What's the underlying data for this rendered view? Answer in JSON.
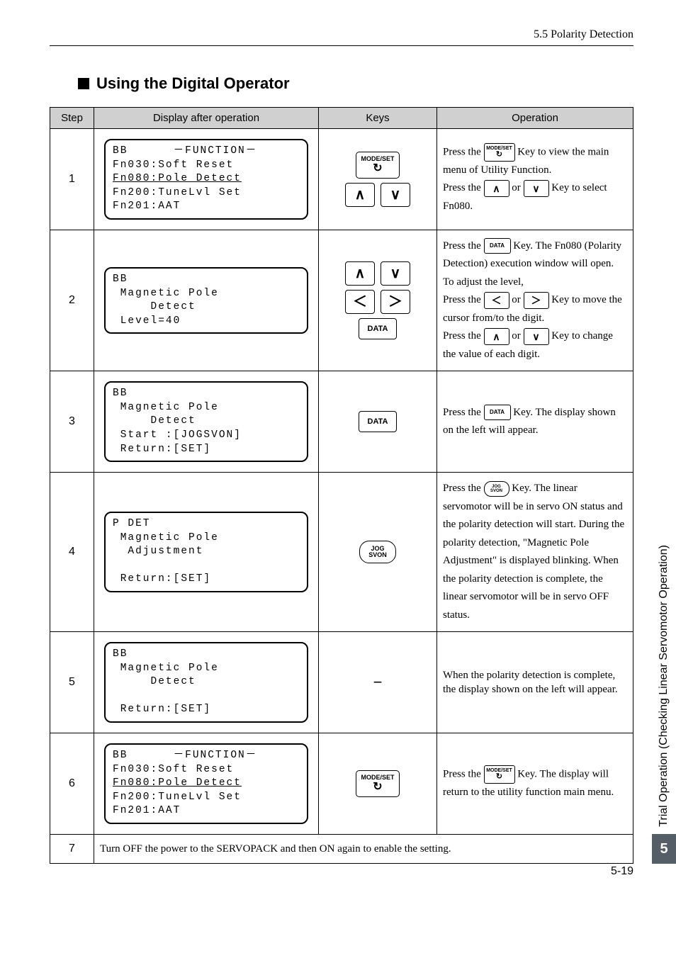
{
  "header": {
    "right": "5.5  Polarity Detection"
  },
  "section_title": "Using the Digital Operator",
  "table": {
    "headers": {
      "step": "Step",
      "display": "Display after operation",
      "keys": "Keys",
      "operation": "Operation"
    }
  },
  "rows": {
    "r1": {
      "step": "1",
      "lcd": {
        "l1a": "BB",
        "l1b": "－FUNCTION－",
        "l2": "Fn030:Soft Reset",
        "l3": "Fn080:Pole Detect",
        "l4": "Fn200:TuneLvl Set",
        "l5": "Fn201:AAT"
      },
      "keys": {
        "modeset": "MODE/SET",
        "up": "∧",
        "down": "∨"
      },
      "op": {
        "t1a": "Press the ",
        "t1b": " Key to view the main menu of Utility Function.",
        "t2a": "Press the ",
        "t2b": " or ",
        "t2c": " Key to select Fn080."
      }
    },
    "r2": {
      "step": "2",
      "lcd": {
        "l1": "BB",
        "l2": " Magnetic Pole",
        "l3": "     Detect",
        "l4": " Level=40"
      },
      "keys": {
        "up": "∧",
        "down": "∨",
        "left": "＜",
        "right": "＞",
        "data": "DATA"
      },
      "op": {
        "t1a": "Press the ",
        "t1b": " Key. The Fn080 (Polarity Detection) execution window will open.",
        "t2": "To adjust the level,",
        "t3a": "Press the ",
        "t3b": " or ",
        "t3c": " Key to move the cursor from/to the digit.",
        "t4a": "Press the ",
        "t4b": " or ",
        "t4c": " Key to change the value of each digit."
      }
    },
    "r3": {
      "step": "3",
      "lcd": {
        "l1": "BB",
        "l2": " Magnetic Pole",
        "l3": "     Detect",
        "l4": " Start :[JOGSVON]",
        "l5": " Return:[SET]"
      },
      "keys": {
        "data": "DATA"
      },
      "op": {
        "t1a": "Press the ",
        "t1b": " Key. The display shown on the left will appear."
      }
    },
    "r4": {
      "step": "4",
      "lcd": {
        "l1": "P DET",
        "l2": " Magnetic Pole",
        "l3": "  Adjustment",
        "l4": "",
        "l5": " Return:[SET]"
      },
      "keys": {
        "jog1": "JOG",
        "jog2": "SVON"
      },
      "op": {
        "t1a": "Press the ",
        "t1b": " Key. The linear servomotor will be in servo ON status and the polarity detection will start. During the polarity detection, \"Magnetic Pole Adjustment\" is displayed blinking. When the polarity detection is complete, the linear servomotor will be in servo OFF status."
      }
    },
    "r5": {
      "step": "5",
      "lcd": {
        "l1": "BB",
        "l2": " Magnetic Pole",
        "l3": "     Detect",
        "l4": "",
        "l5": " Return:[SET]"
      },
      "keys": {
        "dash": "−"
      },
      "op": {
        "t1": "When the polarity detection is complete, the display shown on the left will appear."
      }
    },
    "r6": {
      "step": "6",
      "lcd": {
        "l1a": "BB",
        "l1b": "－FUNCTION－",
        "l2": "Fn030:Soft Reset",
        "l3": "Fn080:Pole Detect",
        "l4": "Fn200:TuneLvl Set",
        "l5": "Fn201:AAT"
      },
      "keys": {
        "modeset": "MODE/SET"
      },
      "op": {
        "t1a": "Press the ",
        "t1b": " Key. The display will return to the utility function main menu."
      }
    },
    "r7": {
      "step": "7",
      "text": "Turn OFF the power to the SERVOPACK and then ON again to enable the setting."
    }
  },
  "inline_keys": {
    "modeset": "MODE/SET",
    "loop": "↻",
    "up": "∧",
    "down": "∨",
    "left": "＜",
    "right": "＞",
    "data": "DATA",
    "jog1": "JOG",
    "jog2": "SVON"
  },
  "side": {
    "text": "Trial Operation (Checking Linear Servomotor Operation)",
    "num": "5"
  },
  "footer": {
    "page": "5-19"
  }
}
